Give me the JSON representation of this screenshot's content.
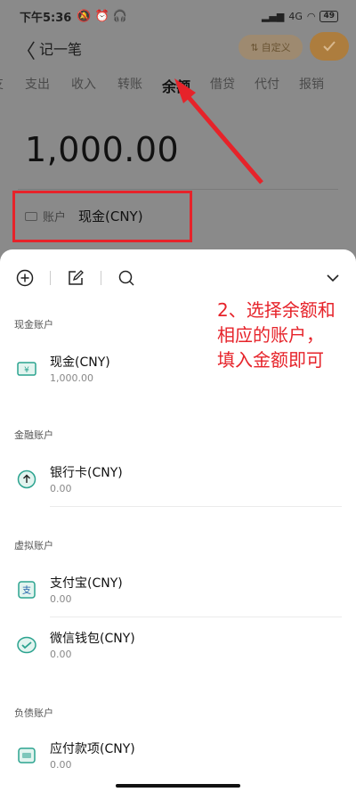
{
  "status": {
    "time": "下午5:36",
    "battery": "49",
    "network": "4G"
  },
  "header": {
    "title": "记一笔",
    "custom_label": "自定义"
  },
  "tabs": [
    "支出",
    "收入",
    "转账",
    "余额",
    "借贷",
    "代付",
    "报销"
  ],
  "active_tab": "余额",
  "amount": "1,000.00",
  "account_field": {
    "label": "账户",
    "value": "现金(CNY)"
  },
  "sections": {
    "cash": {
      "title": "现金账户",
      "items": [
        {
          "name": "现金(CNY)",
          "balance": "1,000.00",
          "icon": "cash-icon"
        }
      ]
    },
    "finance": {
      "title": "金融账户",
      "items": [
        {
          "name": "银行卡(CNY)",
          "balance": "0.00",
          "icon": "bank-card-icon"
        }
      ]
    },
    "virtual": {
      "title": "虚拟账户",
      "items": [
        {
          "name": "支付宝(CNY)",
          "balance": "0.00",
          "icon": "alipay-icon"
        },
        {
          "name": "微信钱包(CNY)",
          "balance": "0.00",
          "icon": "wechat-icon"
        }
      ]
    },
    "debt": {
      "title": "负债账户",
      "items": [
        {
          "name": "应付款项(CNY)",
          "balance": "0.00",
          "icon": "payable-icon"
        }
      ]
    }
  },
  "annotation": {
    "line1": "2、选择余额和",
    "line2": "相应的账户，",
    "line3": "填入金额即可"
  },
  "colors": {
    "accent": "#ad7d3e",
    "annotation_red": "#e6232a",
    "icon_teal": "#2ba38f"
  }
}
